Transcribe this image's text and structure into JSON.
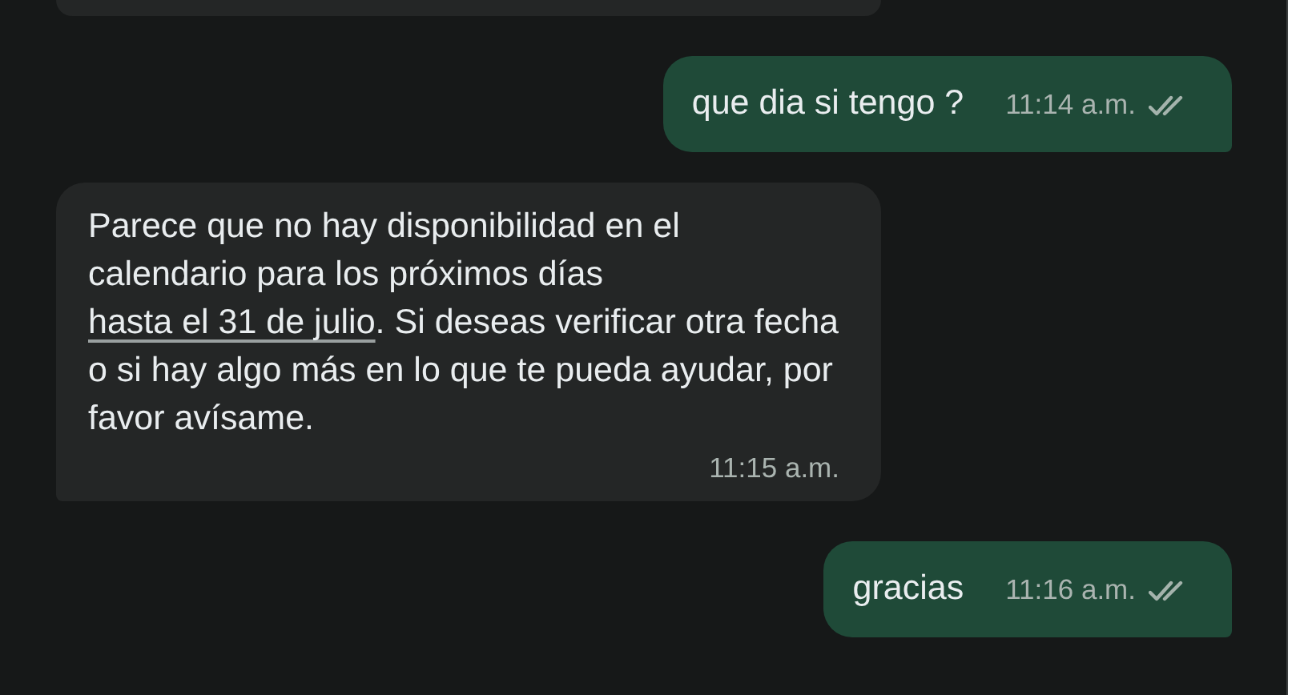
{
  "messages": [
    {
      "kind": "incoming_partial"
    },
    {
      "kind": "outgoing",
      "parts": [
        {
          "text": "que dia si tengo ?",
          "link": false
        }
      ],
      "time": "11:14 a.m.",
      "read": false
    },
    {
      "kind": "incoming",
      "parts": [
        {
          "text": "Parece que no hay disponibilidad en el calendario para los próximos días ",
          "link": false
        },
        {
          "text": "hasta el 31 de julio",
          "link": true
        },
        {
          "text": ". Si deseas verificar otra fecha o si hay algo más en lo que te pueda ayudar, por favor avísame.",
          "link": false
        }
      ],
      "time": "11:15 a.m."
    },
    {
      "kind": "outgoing",
      "parts": [
        {
          "text": "gracias",
          "link": false
        }
      ],
      "time": "11:16 a.m.",
      "read": false
    }
  ]
}
